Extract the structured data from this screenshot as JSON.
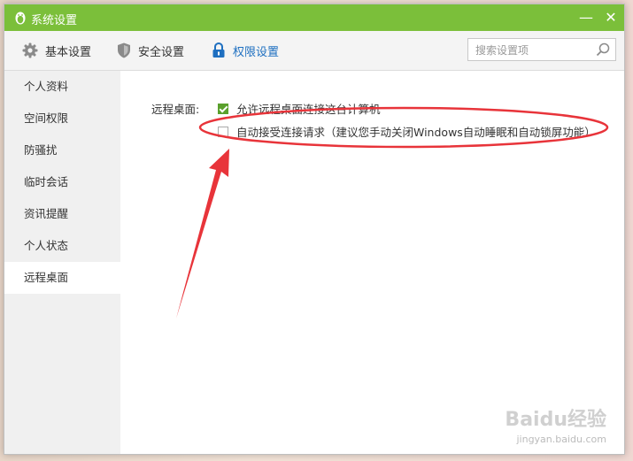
{
  "window": {
    "title": "系统设置",
    "minimize_symbol": "—",
    "close_symbol": "✕"
  },
  "toolbar": {
    "tabs": [
      {
        "label": "基本设置",
        "icon": "gear-icon"
      },
      {
        "label": "安全设置",
        "icon": "shield-icon"
      },
      {
        "label": "权限设置",
        "icon": "lock-icon",
        "active": true
      }
    ],
    "search_placeholder": "搜索设置项"
  },
  "sidebar": {
    "items": [
      {
        "label": "个人资料"
      },
      {
        "label": "空间权限"
      },
      {
        "label": "防骚扰"
      },
      {
        "label": "临时会话"
      },
      {
        "label": "资讯提醒"
      },
      {
        "label": "个人状态"
      },
      {
        "label": "远程桌面",
        "active": true
      }
    ]
  },
  "content": {
    "field_label": "远程桌面:",
    "options": [
      {
        "label": "允许远程桌面连接这台计算机",
        "checked": true
      },
      {
        "label": "自动接受连接请求（建议您手动关闭Windows自动睡眠和自动锁屏功能）",
        "checked": false
      }
    ]
  },
  "watermark": {
    "logo": "Baidu经验",
    "url": "jingyan.baidu.com"
  },
  "colors": {
    "titlebar": "#7bbf3a",
    "active_tab": "#1e6fc0",
    "checkbox": "#5aa02c",
    "annotation": "#e8343a"
  }
}
